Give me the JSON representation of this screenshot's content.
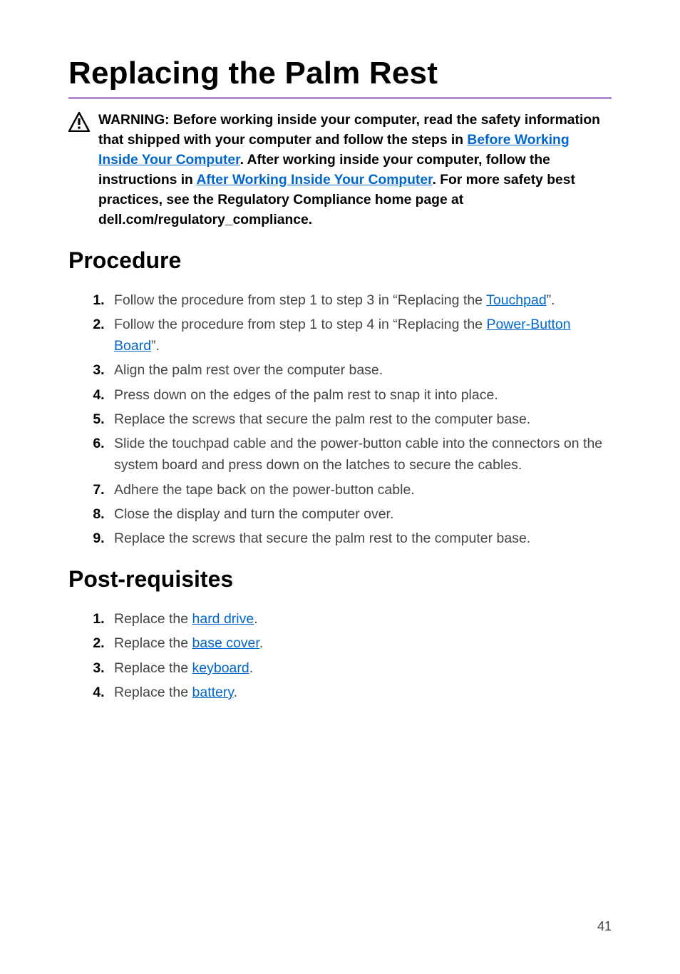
{
  "title": "Replacing the Palm Rest",
  "warning": {
    "t1": "WARNING: Before working inside your computer, read the safety information that shipped with your computer and follow the steps in ",
    "link1": "Before Working Inside Your Computer",
    "t2": ". After working inside your computer, follow the instructions in ",
    "link2": "After Working Inside Your Computer",
    "t3": ". For more safety best practices, see the Regulatory Compliance home page at dell.com/regulatory_compliance."
  },
  "sections": {
    "procedure_heading": "Procedure",
    "post_heading": "Post-requisites"
  },
  "procedure": {
    "s1a": "Follow the procedure from step 1 to step 3 in “Replacing the ",
    "s1link": "Touchpad",
    "s1b": "”.",
    "s2a": "Follow the procedure from step 1 to step 4 in “Replacing the ",
    "s2link": "Power-Button Board",
    "s2b": "”.",
    "s3": "Align the palm rest over the computer base.",
    "s4": "Press down on the edges of the palm rest to snap it into place.",
    "s5": "Replace the screws that secure the palm rest to the computer base.",
    "s6": "Slide the touchpad cable and the power-button cable into the connectors on the system board and press down on the latches to secure the cables.",
    "s7": "Adhere the tape back on the power-button cable.",
    "s8": "Close the display and turn the computer over.",
    "s9": "Replace the screws that secure the palm rest to the computer base."
  },
  "post": {
    "p1a": "Replace the ",
    "p1link": "hard drive",
    "p1b": ".",
    "p2a": "Replace the ",
    "p2link": "base cover",
    "p2b": ".",
    "p3a": "Replace the ",
    "p3link": "keyboard",
    "p3b": ".",
    "p4a": "Replace the ",
    "p4link": "battery",
    "p4b": "."
  },
  "pageNumber": "41"
}
